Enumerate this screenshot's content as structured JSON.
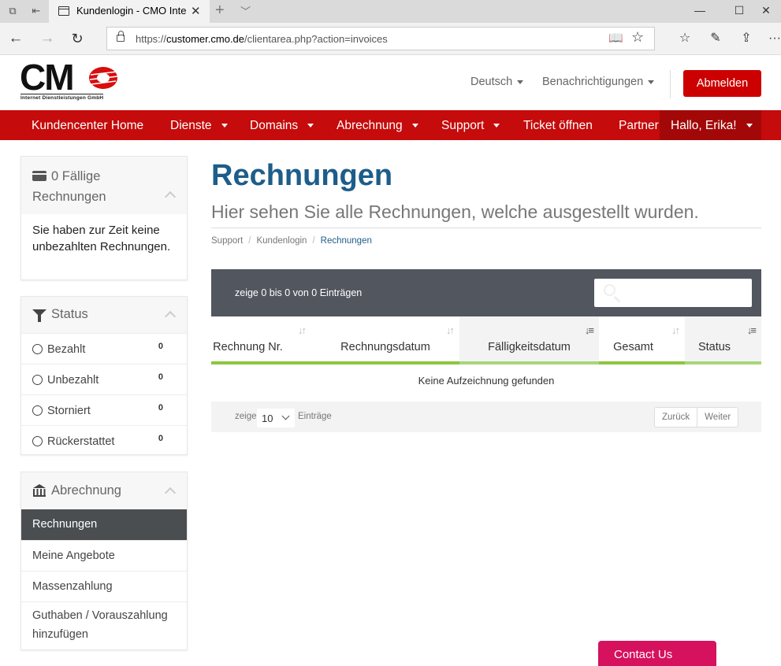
{
  "browser": {
    "tab_title": "Kundenlogin - CMO Inte",
    "url_prefix": "https://",
    "url_host": "customer.cmo.de",
    "url_path": "/clientarea.php?action=invoices"
  },
  "header": {
    "logo_text": "CM",
    "logo_subtitle": "Internet Dienstleistungen GmbH",
    "language": "Deutsch",
    "notifications": "Benachrichtigungen",
    "logout": "Abmelden"
  },
  "nav": {
    "items": [
      "Kundencenter Home",
      "Dienste",
      "Domains",
      "Abrechnung",
      "Support",
      "Ticket öffnen",
      "Partner"
    ],
    "user": "Hallo, Erika!"
  },
  "sidebar": {
    "due": {
      "title": "0 Fällige Rechnungen",
      "message": "Sie haben zur Zeit keine unbezahlten Rechnungen."
    },
    "status": {
      "title": "Status",
      "items": [
        {
          "label": "Bezahlt",
          "count": "0"
        },
        {
          "label": "Unbezahlt",
          "count": "0"
        },
        {
          "label": "Storniert",
          "count": "0"
        },
        {
          "label": "Rückerstattet",
          "count": "0"
        }
      ]
    },
    "billing": {
      "title": "Abrechnung",
      "items": [
        "Rechnungen",
        "Meine Angebote",
        "Massenzahlung",
        "Guthaben / Vorauszahlung hinzufügen"
      ],
      "active": "Rechnungen"
    }
  },
  "content": {
    "title": "Rechnungen",
    "subtitle": "Hier sehen Sie alle Rechnungen, welche ausgestellt wurden.",
    "breadcrumb": [
      "Support",
      "Kundenlogin",
      "Rechnungen"
    ],
    "table": {
      "info": "zeige 0 bis 0 von 0 Einträgen",
      "columns": [
        "Rechnung Nr.",
        "Rechnungsdatum",
        "Fälligkeitsdatum",
        "Gesamt",
        "Status"
      ],
      "empty": "Keine Aufzeichnung gefunden",
      "length_prefix": "zeige",
      "length_value": "10",
      "length_suffix": "Einträge",
      "prev": "Zurück",
      "next": "Weiter"
    }
  },
  "contact_button": "Contact Us",
  "colors": {
    "brand_red": "#c50b0b",
    "title_blue": "#1d5d8a",
    "contact_pink": "#d6115e",
    "table_header_bg": "#52565f",
    "column_underline": "#8cc63f"
  }
}
